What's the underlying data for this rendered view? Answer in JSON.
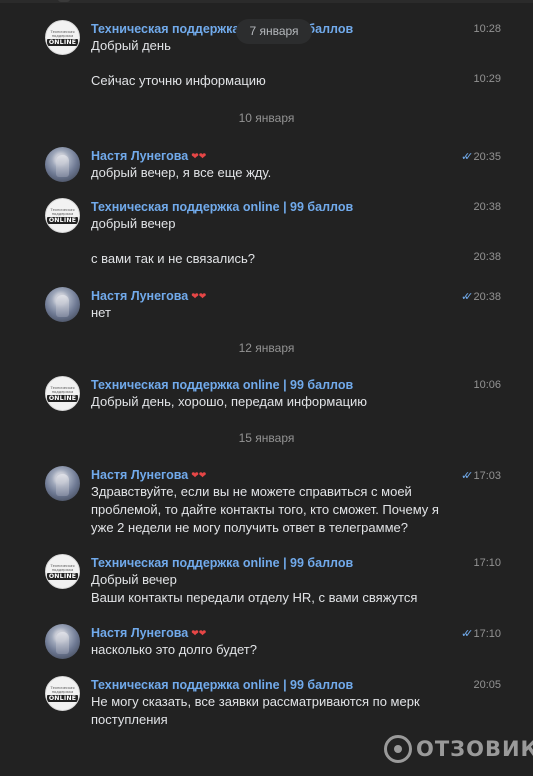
{
  "floating_date": "7 января",
  "watermark": {
    "text": "ОТЗОВИК"
  },
  "support_avatar": {
    "line1": "Техническая",
    "line2": "поддержка",
    "line3": "ONLINE"
  },
  "date_separators": [
    "10 января",
    "12 января",
    "15 января"
  ],
  "messages": [
    {
      "author": "Техническая поддержка online | 99 баллов",
      "lines": [
        "Добрый день"
      ],
      "time": "10:28"
    },
    {
      "lines": [
        "Сейчас уточню информацию"
      ],
      "time": "10:29"
    },
    {
      "author": "Настя Лунегова",
      "lines": [
        "добрый вечер, я все еще жду."
      ],
      "time": "20:35",
      "read_ticks": true
    },
    {
      "author": "Техническая поддержка online | 99 баллов",
      "lines": [
        "добрый вечер"
      ],
      "time": "20:38"
    },
    {
      "lines": [
        "с вами так и не связались?"
      ],
      "time": "20:38"
    },
    {
      "author": "Настя Лунегова",
      "lines": [
        "нет"
      ],
      "time": "20:38",
      "read_ticks": true
    },
    {
      "author": "Техническая поддержка online | 99 баллов",
      "lines": [
        "Добрый день, хорошо, передам информацию"
      ],
      "time": "10:06"
    },
    {
      "author": "Настя Лунегова",
      "lines": [
        "Здравствуйте, если вы не можете справиться с моей",
        "проблемой, то дайте контакты того, кто сможет. Почему я",
        "уже 2 недели не могу получить ответ в телеграмме?"
      ],
      "time": "17:03",
      "read_ticks": true
    },
    {
      "author": "Техническая поддержка online | 99 баллов",
      "lines": [
        "Добрый вечер",
        "Ваши контакты передали отделу HR, с вами свяжутся"
      ],
      "time": "17:10"
    },
    {
      "author": "Настя Лунегова",
      "lines": [
        "насколько это долго будет?"
      ],
      "time": "17:10",
      "read_ticks": true
    },
    {
      "author": "Техническая поддержка online | 99 баллов",
      "lines": [
        "Не могу сказать, все заявки рассматриваются по мерк",
        "поступления"
      ],
      "time": "20:05"
    }
  ]
}
